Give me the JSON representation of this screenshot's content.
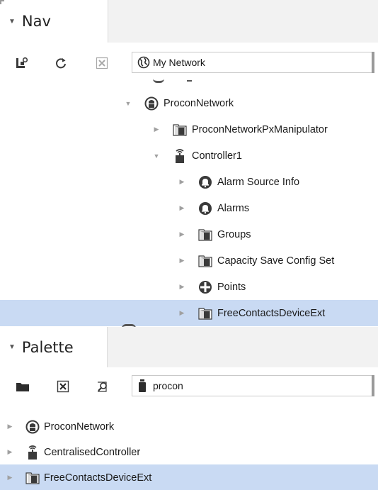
{
  "nav": {
    "title": "Nav",
    "collapse_icon": "caret-down-icon",
    "toolbar": {
      "sync_icon": "sync-station-icon",
      "refresh_icon": "refresh-icon",
      "close_icon": "close-icon"
    },
    "root_selector": {
      "value": "My Network",
      "icon": "globe-icon"
    },
    "tree": [
      {
        "label": "ProconNetwork",
        "icon": "network-icon",
        "expanded": true
      },
      {
        "label": "ProconNetworkPxManipulator",
        "icon": "folder-cube-icon",
        "expanded": false
      },
      {
        "label": "Controller1",
        "icon": "controller-icon",
        "expanded": true
      },
      {
        "label": "Alarm Source Info",
        "icon": "alarm-bell-icon",
        "expanded": false
      },
      {
        "label": "Alarms",
        "icon": "alarm-bell-icon",
        "expanded": false
      },
      {
        "label": "Groups",
        "icon": "folder-cube-icon",
        "expanded": false
      },
      {
        "label": "Capacity Save Config Set",
        "icon": "folder-cube-icon",
        "expanded": false
      },
      {
        "label": "Points",
        "icon": "points-icon",
        "expanded": false
      },
      {
        "label": "FreeContactsDeviceExt",
        "icon": "folder-cube-icon",
        "expanded": false,
        "selected": true
      }
    ]
  },
  "palette": {
    "title": "Palette",
    "collapse_icon": "caret-down-icon",
    "toolbar": {
      "open_icon": "folder-icon",
      "close_icon": "close-icon",
      "find_icon": "find-icon"
    },
    "module_selector": {
      "value": "procon",
      "icon": "module-jar-icon"
    },
    "items": [
      {
        "label": "ProconNetwork",
        "icon": "network-icon"
      },
      {
        "label": "CentralisedController",
        "icon": "controller-icon"
      },
      {
        "label": "FreeContactsDeviceExt",
        "icon": "folder-cube-icon",
        "selected": true
      }
    ]
  },
  "colors": {
    "selection": "#c9daf3",
    "icon_dark": "#3a3a3a"
  }
}
